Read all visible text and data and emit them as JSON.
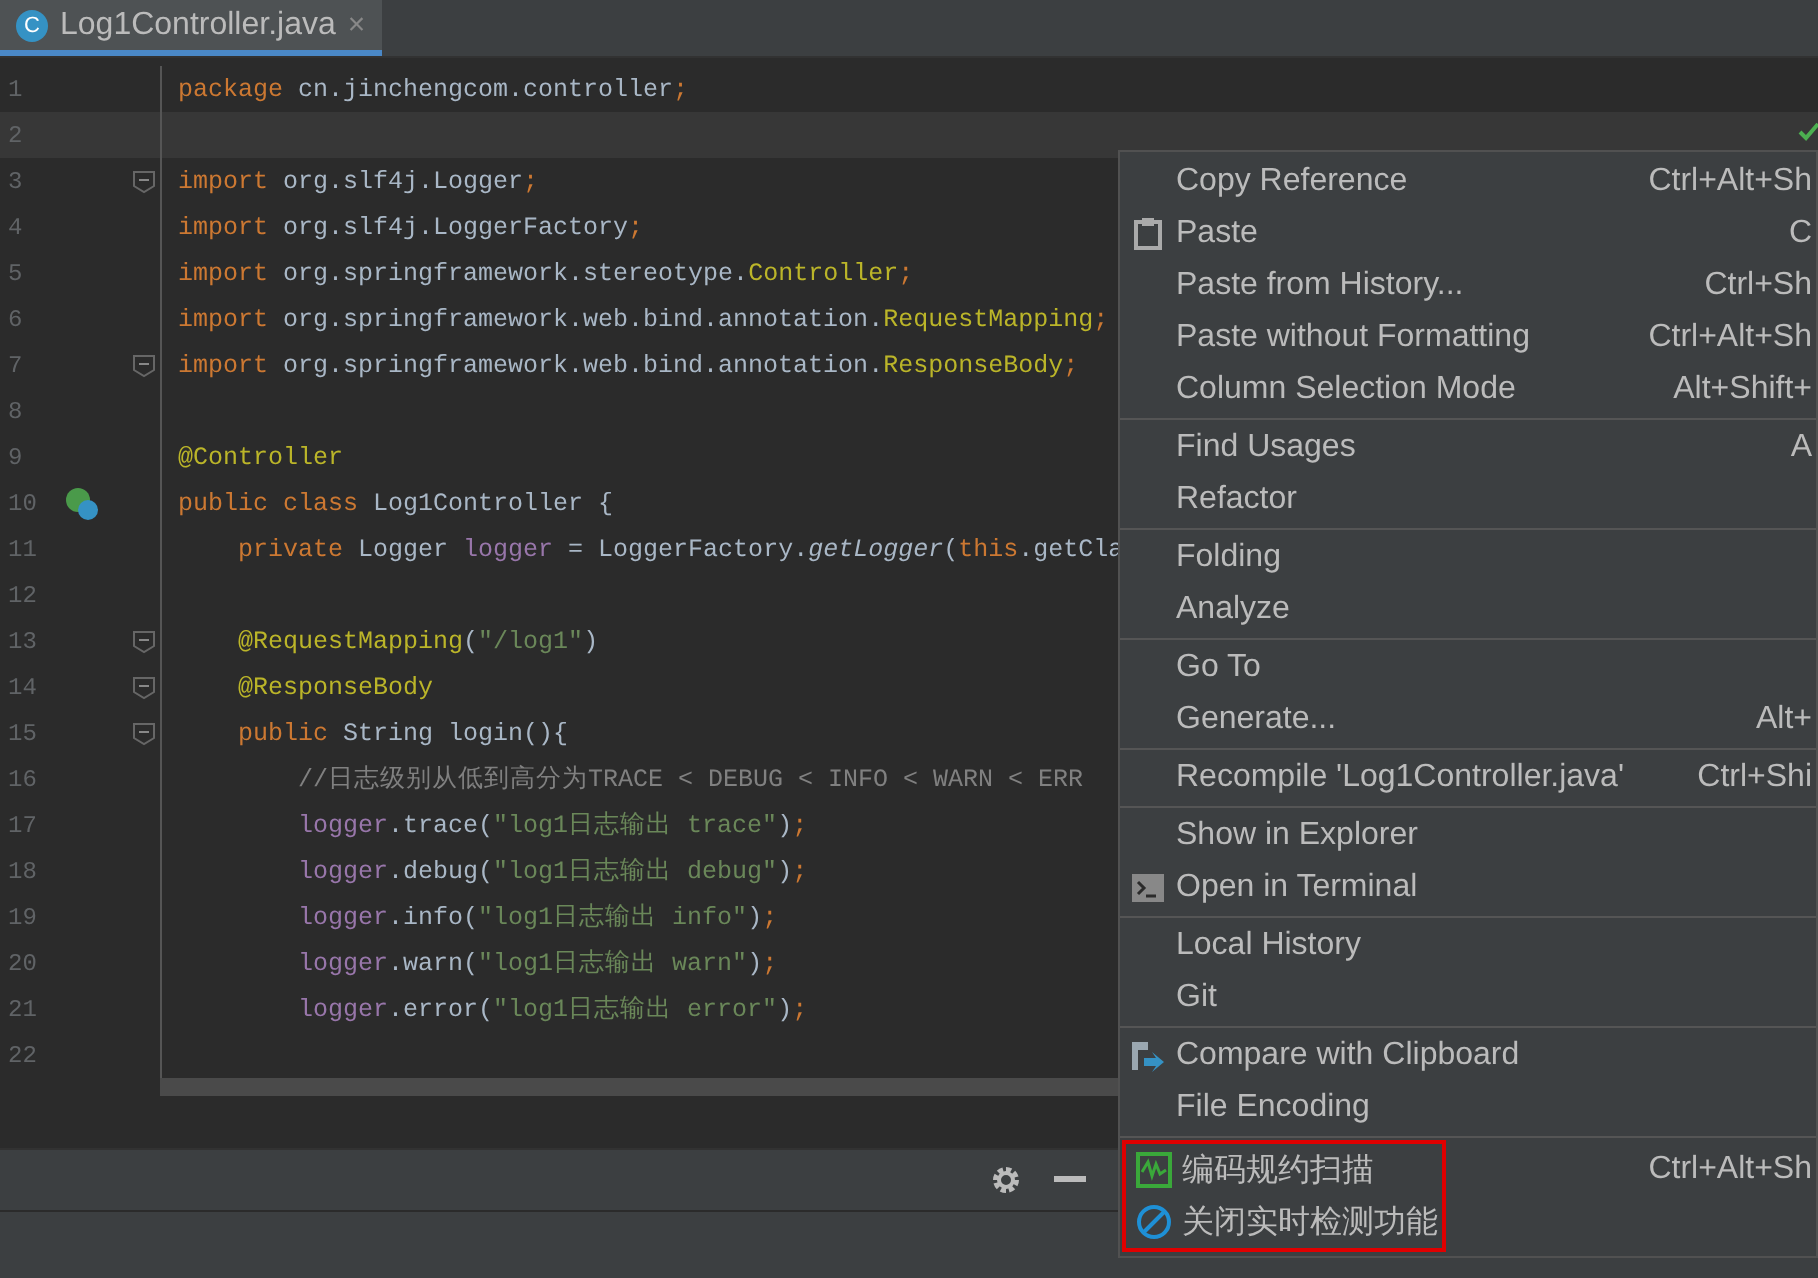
{
  "tabs": [
    {
      "label": "Log1Controller.java",
      "selected": true,
      "icon": "C",
      "close": "×"
    }
  ],
  "code_lines": [
    {
      "number": "1",
      "current": false,
      "kind": "plain",
      "tokens": [
        {
          "kind": "keyword",
          "text": "package "
        },
        {
          "kind": "plain",
          "text": "cn.jinchengcom.controller"
        },
        {
          "kind": "punct",
          "text": ";"
        }
      ]
    },
    {
      "number": "2",
      "current": true,
      "kind": "plain"
    },
    {
      "number": "3",
      "current": false,
      "kind": "fold",
      "tokens": [
        {
          "kind": "keyword",
          "text": "import "
        },
        {
          "kind": "plain",
          "text": "org.slf4j.Logger"
        },
        {
          "kind": "punct",
          "text": ";"
        }
      ]
    },
    {
      "number": "4",
      "current": false,
      "kind": "plain",
      "tokens": [
        {
          "kind": "keyword",
          "text": "import "
        },
        {
          "kind": "plain",
          "text": "org.slf4j.LoggerFactory"
        },
        {
          "kind": "punct",
          "text": ";"
        }
      ]
    },
    {
      "number": "5",
      "current": false,
      "kind": "plain",
      "tokens": [
        {
          "kind": "keyword",
          "text": "import "
        },
        {
          "kind": "plain",
          "text": "org.springframework.stereotype."
        },
        {
          "kind": "annotation",
          "text": "Controller"
        },
        {
          "kind": "punct",
          "text": ";"
        }
      ]
    },
    {
      "number": "6",
      "current": false,
      "kind": "plain",
      "tokens": [
        {
          "kind": "keyword",
          "text": "import "
        },
        {
          "kind": "plain",
          "text": "org.springframework.web.bind.annotation."
        },
        {
          "kind": "annotation",
          "text": "RequestMapping"
        },
        {
          "kind": "punct",
          "text": ";"
        }
      ]
    },
    {
      "number": "7",
      "current": false,
      "kind": "fold",
      "tokens": [
        {
          "kind": "keyword",
          "text": "import "
        },
        {
          "kind": "plain",
          "text": "org.springframework.web.bind.annotation."
        },
        {
          "kind": "annotation",
          "text": "ResponseBody"
        },
        {
          "kind": "punct",
          "text": ";"
        }
      ]
    },
    {
      "number": "8",
      "current": false,
      "kind": "plain"
    },
    {
      "number": "9",
      "current": false,
      "kind": "plain",
      "tokens": [
        {
          "kind": "annotation",
          "text": "@Controller"
        }
      ]
    },
    {
      "number": "10",
      "current": false,
      "kind": "bean",
      "tokens": [
        {
          "kind": "keyword",
          "text": "public class "
        },
        {
          "kind": "plain",
          "text": "Log1Controller {"
        }
      ]
    },
    {
      "number": "11",
      "current": false,
      "kind": "plain",
      "tokens": [
        {
          "kind": "keyword",
          "text": "    private "
        },
        {
          "kind": "plain",
          "text": "Logger "
        },
        {
          "kind": "field",
          "text": "logger "
        },
        {
          "kind": "plain",
          "text": "= LoggerFactory."
        },
        {
          "kind": "static",
          "text": "getLogger"
        },
        {
          "kind": "plain",
          "text": "("
        },
        {
          "kind": "keyword",
          "text": "this"
        },
        {
          "kind": "plain",
          "text": ".getCla"
        }
      ]
    },
    {
      "number": "12",
      "current": false,
      "kind": "plain"
    },
    {
      "number": "13",
      "current": false,
      "kind": "fold",
      "tokens": [
        {
          "kind": "annotation",
          "text": "    @RequestMapping"
        },
        {
          "kind": "plain",
          "text": "("
        },
        {
          "kind": "string",
          "text": "\"/log1\""
        },
        {
          "kind": "plain",
          "text": ")"
        }
      ]
    },
    {
      "number": "14",
      "current": false,
      "kind": "fold",
      "tokens": [
        {
          "kind": "annotation",
          "text": "    @ResponseBody"
        }
      ]
    },
    {
      "number": "15",
      "current": false,
      "kind": "fold",
      "tokens": [
        {
          "kind": "keyword",
          "text": "    public "
        },
        {
          "kind": "plain",
          "text": "String login(){"
        }
      ]
    },
    {
      "number": "16",
      "current": false,
      "kind": "plain",
      "tokens": [
        {
          "kind": "comment",
          "text": "        //日志级别从低到高分为TRACE < DEBUG < INFO < WARN < ERR"
        }
      ]
    },
    {
      "number": "17",
      "current": false,
      "kind": "plain",
      "tokens": [
        {
          "kind": "field",
          "text": "        logger"
        },
        {
          "kind": "plain",
          "text": ".trace("
        },
        {
          "kind": "string",
          "text": "\"log1日志输出 trace\""
        },
        {
          "kind": "plain",
          "text": ")"
        },
        {
          "kind": "punct",
          "text": ";"
        }
      ]
    },
    {
      "number": "18",
      "current": false,
      "kind": "plain",
      "tokens": [
        {
          "kind": "field",
          "text": "        logger"
        },
        {
          "kind": "plain",
          "text": ".debug("
        },
        {
          "kind": "string",
          "text": "\"log1日志输出 debug\""
        },
        {
          "kind": "plain",
          "text": ")"
        },
        {
          "kind": "punct",
          "text": ";"
        }
      ]
    },
    {
      "number": "19",
      "current": false,
      "kind": "plain",
      "tokens": [
        {
          "kind": "field",
          "text": "        logger"
        },
        {
          "kind": "plain",
          "text": ".info("
        },
        {
          "kind": "string",
          "text": "\"log1日志输出 info\""
        },
        {
          "kind": "plain",
          "text": ")"
        },
        {
          "kind": "punct",
          "text": ";"
        }
      ]
    },
    {
      "number": "20",
      "current": false,
      "kind": "plain",
      "tokens": [
        {
          "kind": "field",
          "text": "        logger"
        },
        {
          "kind": "plain",
          "text": ".warn("
        },
        {
          "kind": "string",
          "text": "\"log1日志输出 warn\""
        },
        {
          "kind": "plain",
          "text": ")"
        },
        {
          "kind": "punct",
          "text": ";"
        }
      ]
    },
    {
      "number": "21",
      "current": false,
      "kind": "plain",
      "tokens": [
        {
          "kind": "field",
          "text": "        logger"
        },
        {
          "kind": "plain",
          "text": ".error("
        },
        {
          "kind": "string",
          "text": "\"log1日志输出 error\""
        },
        {
          "kind": "plain",
          "text": ")"
        },
        {
          "kind": "punct",
          "text": ";"
        }
      ]
    },
    {
      "number": "22",
      "current": false,
      "kind": "plain"
    }
  ],
  "context_menu": {
    "groups": [
      {
        "highlighted": false,
        "items": [
          {
            "label": "Copy Reference",
            "shortcut": "Ctrl+Alt+Sh",
            "kind": "plain"
          },
          {
            "label": "Paste",
            "shortcut": "C",
            "kind": "clipboard"
          },
          {
            "label": "Paste from History...",
            "shortcut": "Ctrl+Sh",
            "kind": "plain"
          },
          {
            "label": "Paste without Formatting",
            "shortcut": "Ctrl+Alt+Sh",
            "kind": "plain"
          },
          {
            "label": "Column Selection Mode",
            "shortcut": "Alt+Shift+",
            "kind": "plain"
          }
        ]
      },
      {
        "highlighted": false,
        "items": [
          {
            "label": "Find Usages",
            "shortcut": "A",
            "kind": "plain"
          },
          {
            "label": "Refactor",
            "kind": "plain"
          }
        ]
      },
      {
        "highlighted": false,
        "items": [
          {
            "label": "Folding",
            "kind": "plain"
          },
          {
            "label": "Analyze",
            "kind": "plain"
          }
        ]
      },
      {
        "highlighted": false,
        "items": [
          {
            "label": "Go To",
            "kind": "plain"
          },
          {
            "label": "Generate...",
            "shortcut": "Alt+",
            "kind": "plain"
          }
        ]
      },
      {
        "highlighted": false,
        "items": [
          {
            "label": "Recompile 'Log1Controller.java'",
            "shortcut": "Ctrl+Shi",
            "kind": "plain"
          }
        ]
      },
      {
        "highlighted": false,
        "items": [
          {
            "label": "Show in Explorer",
            "kind": "plain"
          },
          {
            "label": "Open in Terminal",
            "kind": "terminal"
          }
        ]
      },
      {
        "highlighted": false,
        "items": [
          {
            "label": "Local History",
            "kind": "plain"
          },
          {
            "label": "Git",
            "kind": "plain"
          }
        ]
      },
      {
        "highlighted": false,
        "items": [
          {
            "label": "Compare with Clipboard",
            "kind": "compare"
          },
          {
            "label": "File Encoding",
            "kind": "plain"
          }
        ]
      },
      {
        "highlighted": true,
        "items": [
          {
            "label": "编码规约扫描",
            "shortcut": "Ctrl+Alt+Sh",
            "kind": "scan"
          },
          {
            "label": "关闭实时检测功能",
            "kind": "forbid"
          }
        ]
      }
    ]
  }
}
